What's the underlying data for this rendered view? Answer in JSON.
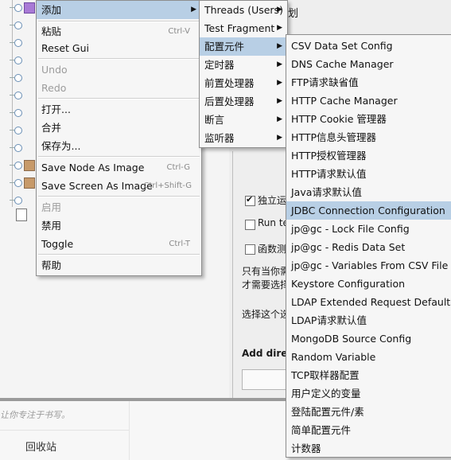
{
  "main_menu": {
    "add": "添加",
    "paste": "粘贴",
    "paste_shortcut": "Ctrl-V",
    "reset_gui": "Reset Gui",
    "undo": "Undo",
    "redo": "Redo",
    "open": "打开...",
    "merge": "合并",
    "save_as": "保存为...",
    "save_node_as_image": "Save Node As Image",
    "save_node_shortcut": "Ctrl-G",
    "save_screen_as_image": "Save Screen As Image",
    "save_screen_shortcut": "Ctrl+Shift-G",
    "enable": "启用",
    "disable": "禁用",
    "toggle": "Toggle",
    "toggle_shortcut": "Ctrl-T",
    "help": "帮助"
  },
  "add_submenu": {
    "items": [
      "Threads (Users)",
      "Test Fragment",
      "配置元件",
      "定时器",
      "前置处理器",
      "后置处理器",
      "断言",
      "监听器"
    ],
    "selected": "配置元件"
  },
  "config_submenu": {
    "items": [
      "CSV Data Set Config",
      "DNS Cache Manager",
      "FTP请求缺省值",
      "HTTP Cache Manager",
      "HTTP Cookie 管理器",
      "HTTP信息头管理器",
      "HTTP授权管理器",
      "HTTP请求默认值",
      "Java请求默认值",
      "JDBC Connection Configuration",
      "jp@gc - Lock File Config",
      "jp@gc - Redis Data Set",
      "jp@gc - Variables From CSV File",
      "Keystore Configuration",
      "LDAP Extended Request Defaults",
      "LDAP请求默认值",
      "MongoDB Source Config",
      "Random Variable",
      "TCP取样器配置",
      "用户定义的变量",
      "登陆配置元件/素",
      "简单配置元件",
      "计数器"
    ],
    "selected": "JDBC Connection Configuration"
  },
  "background": {
    "title_fragment": "划",
    "checkbox_independent": "独立运",
    "checkbox_run": "Run te",
    "checkbox_functional": "函数测",
    "note_line1": "只有当你需",
    "note_line2": "才需要选择",
    "note_line3": "选择这个选",
    "add_directory": "Add direct",
    "web_hint": "让你专注于书写。",
    "recycle_bin": "回收站"
  }
}
